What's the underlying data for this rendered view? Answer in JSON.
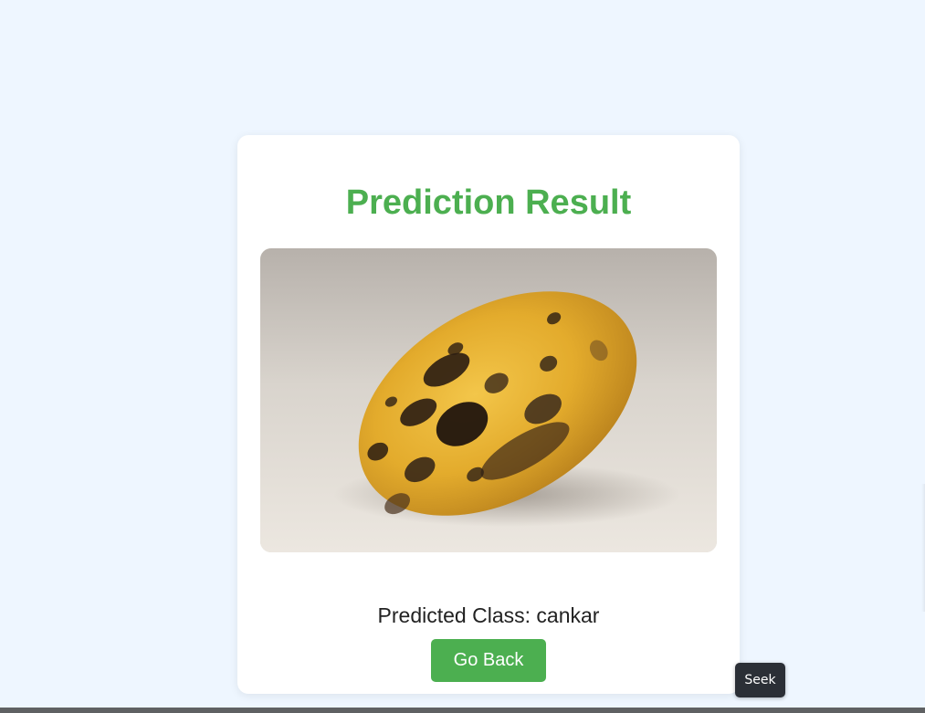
{
  "page": {
    "title": "Prediction Result",
    "predicted_prefix": "Predicted Class: ",
    "predicted_class": "cankar",
    "back_button_label": "Go Back"
  },
  "image": {
    "alt": "mango",
    "subject": "yellow mango with dark spots"
  },
  "overlay": {
    "seek_label": "Seek"
  },
  "colors": {
    "page_background": "#eef6ff",
    "card_background": "#ffffff",
    "accent_green": "#4caf50",
    "text_dark": "#222222",
    "seek_background": "#2b2f36",
    "bottom_bar": "#5f6163"
  }
}
